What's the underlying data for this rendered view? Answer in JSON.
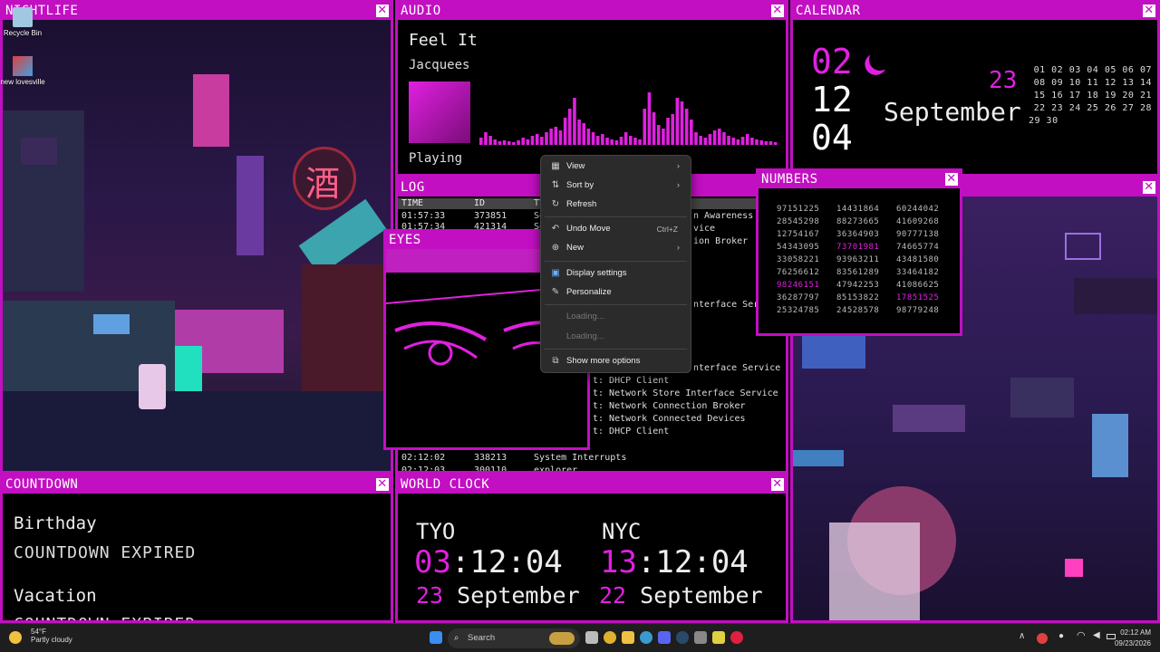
{
  "panels": {
    "nightlife": {
      "title": "NIGHTLIFE"
    },
    "audio": {
      "title": "AUDIO",
      "track": "Feel It",
      "artist": "Jacquees",
      "state": "Playing"
    },
    "calendar": {
      "title": "CALENDAR",
      "hour": "02",
      "minute": "12",
      "second": "04",
      "day": "23",
      "month": "September",
      "grid": [
        "01 02 03 04 05 06 07",
        "08 09 10 11 12 13 14",
        "15 16 17 18 19 20 21",
        "22 23 24 25 26 27 28",
        "29 30"
      ]
    },
    "log": {
      "title": "LOG",
      "headers": [
        "TIME",
        "ID",
        "TY"
      ],
      "rows": [
        {
          "time": "01:57:33",
          "id": "373851",
          "text": "Se"
        },
        {
          "time": "01:57:34",
          "id": "421314",
          "text": "Se"
        }
      ],
      "fragments": [
        "n Awareness",
        "vice",
        "ion Broker",
        "nterface Serv",
        "nterface Service",
        "t: DHCP Client",
        "t: Network Store Interface Service",
        "t: Network Connection Broker",
        "t: Network Connected Devices",
        "t: DHCP Client"
      ],
      "bottom_rows": [
        {
          "time": "02:12:02",
          "id": "338213",
          "text": "System Interrupts"
        },
        {
          "time": "02:12:03",
          "id": "300110",
          "text": "explorer"
        }
      ]
    },
    "eyes": {
      "title": "EYES"
    },
    "numbers": {
      "title": "NUMBERS",
      "rows": [
        [
          "97151225",
          "14431864",
          "60244042"
        ],
        [
          "28545298",
          "88273665",
          "41609268"
        ],
        [
          "12754167",
          "36364903",
          "90777138"
        ],
        [
          "54343095",
          "73701981",
          "74665774"
        ],
        [
          "33058221",
          "93963211",
          "43481580"
        ],
        [
          "76256612",
          "83561289",
          "33464182"
        ],
        [
          "98246151",
          "47942253",
          "41086625"
        ],
        [
          "36287797",
          "85153822",
          "17851525"
        ],
        [
          "25324785",
          "24528578",
          "98779248"
        ]
      ]
    },
    "countdown": {
      "title": "COUNTDOWN",
      "events": [
        {
          "label": "Birthday",
          "value": "COUNTDOWN EXPIRED"
        },
        {
          "label": "Vacation",
          "value": "COUNTDOWN EXPIRED"
        }
      ]
    },
    "worldclock": {
      "title": "WORLD CLOCK",
      "clocks": [
        {
          "city": "TYO",
          "hour": "03",
          "rest": ":12:04",
          "day": "23",
          "month": "September"
        },
        {
          "city": "NYC",
          "hour": "13",
          "rest": ":12:04",
          "day": "22",
          "month": "September"
        }
      ]
    },
    "city": {
      "title": ""
    }
  },
  "context_menu": {
    "view": "View",
    "sort_by": "Sort by",
    "refresh": "Refresh",
    "undo_move": "Undo Move",
    "undo_shortcut": "Ctrl+Z",
    "new": "New",
    "display_settings": "Display settings",
    "personalize": "Personalize",
    "loading1": "Loading...",
    "loading2": "Loading...",
    "more_options": "Show more options"
  },
  "desktop": {
    "recycle_bin": "Recycle Bin",
    "new_app": "new lovesville"
  },
  "taskbar": {
    "temp": "54°F",
    "condition": "Partly cloudy",
    "search": "Search",
    "time": "02:12 AM",
    "date": "09/23/2026"
  },
  "colors": {
    "accent": "#c20fc2",
    "highlight": "#e020e0"
  }
}
